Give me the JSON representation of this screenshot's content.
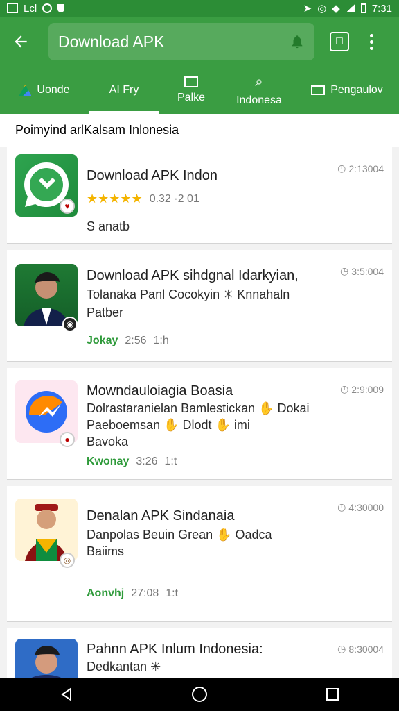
{
  "status": {
    "left_text": "Lcl",
    "time": "7:31"
  },
  "header": {
    "search_text": "Download APK"
  },
  "tabs": [
    {
      "label": "Uonde"
    },
    {
      "label": "AI Fry"
    },
    {
      "label": "Palke"
    },
    {
      "label": "Indonesa"
    },
    {
      "label": "Pengaulov"
    }
  ],
  "subheader": {
    "text": "Poimyind arlKalsam Inlonesia"
  },
  "cards": [
    {
      "title": "Download APK Indon",
      "rating_text": "0.32  ·2 01",
      "line2": "S anatb",
      "time": "2:13004"
    },
    {
      "title": "Download APK sihdgnal Idarkyian,",
      "line2": "Tolanaka Panl Cocokyin ✳ Knnahaln",
      "line3": "Patber",
      "meta_green": "Jokay",
      "meta_time": "2:56",
      "meta_small": "1:h",
      "time": "3:5:004"
    },
    {
      "title": "Mowndauloiagia Boasia",
      "line2": "Dolrastaranielan Bamlestickan ✋ Dokai",
      "line3": "Paeboemsan ✋ Dlodt ✋ imi",
      "line4": "Bavoka",
      "meta_green": "Kwonay",
      "meta_time": "3:26",
      "meta_small": "1:t",
      "time": "2:9:009"
    },
    {
      "title": "Denalan APK Sindanaia",
      "line2": "Danpolas Beuin Grean ✋ Oadca",
      "line3": "Baiims",
      "meta_green": "Aonvhj",
      "meta_time": "27:08",
      "meta_small": "1:t",
      "time": "4:30000"
    },
    {
      "title": "Pahnn APK Inlum Indonesia:",
      "line2": "Dedkantan ✳",
      "time": "8:30004"
    }
  ],
  "colors": {
    "primary": "#3a9d42",
    "status": "#2c8d36",
    "nav_bar": "#000000",
    "card_bg": "#ffffff",
    "star": "#f4b400"
  },
  "icons": {
    "back": "arrow-left-icon",
    "search_action": "notification-bell-icon",
    "menu": "more-vertical-icon",
    "nav_back": "triangle-back-icon",
    "nav_home": "circle-home-icon",
    "nav_recent": "square-recent-icon"
  }
}
